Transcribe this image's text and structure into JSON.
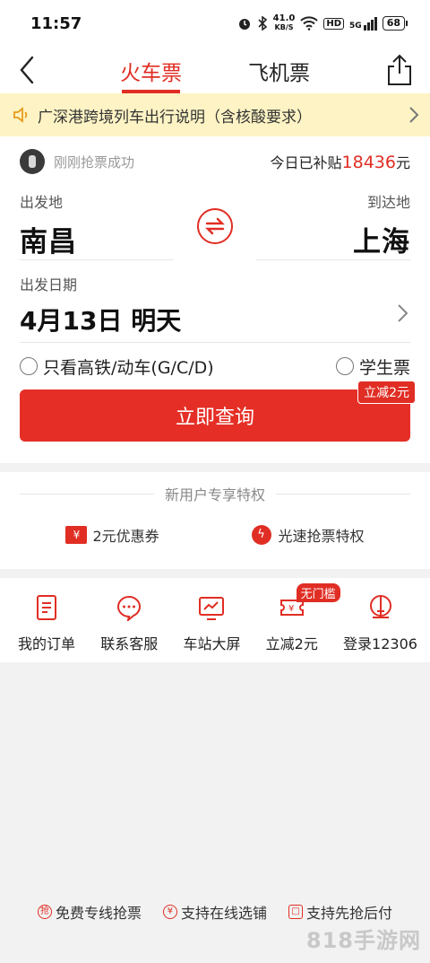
{
  "status_bar": {
    "time": "11:57",
    "speed": "41.0",
    "speed_unit": "KB/S",
    "hd": "HD",
    "network": "5G",
    "battery": "68"
  },
  "nav": {
    "tabs": [
      {
        "label": "火车票",
        "active": true
      },
      {
        "label": "飞机票",
        "active": false
      }
    ]
  },
  "notice": {
    "text": "广深港跨境列车出行说明（含核酸要求）"
  },
  "promo": {
    "left_text": "刚刚抢票成功",
    "right_prefix": "今日已补贴",
    "amount": "18436",
    "unit": "元"
  },
  "route": {
    "from_label": "出发地",
    "from_city": "南昌",
    "to_label": "到达地",
    "to_city": "上海"
  },
  "date": {
    "label": "出发日期",
    "value": "4月13日 明天"
  },
  "options": {
    "high_speed": "只看高铁/动车(G/C/D)",
    "student": "学生票"
  },
  "search": {
    "label": "立即查询",
    "badge": "立减2元"
  },
  "perks": {
    "title": "新用户专享特权",
    "items": [
      {
        "icon": "¥",
        "label": "2元优惠券"
      },
      {
        "icon": "ϟ",
        "label": "光速抢票特权"
      }
    ]
  },
  "quick": {
    "items": [
      {
        "label": "我的订单",
        "icon": "order-icon"
      },
      {
        "label": "联系客服",
        "icon": "chat-icon"
      },
      {
        "label": "车站大屏",
        "icon": "screen-icon"
      },
      {
        "label": "立减2元",
        "icon": "coupon-icon",
        "badge": "无门槛"
      },
      {
        "label": "登录12306",
        "icon": "train-icon"
      }
    ]
  },
  "footer": {
    "items": [
      {
        "icon": "抢",
        "label": "免费专线抢票"
      },
      {
        "icon": "¥",
        "label": "支持在线选铺"
      },
      {
        "icon": "□",
        "label": "支持先抢后付"
      }
    ]
  },
  "watermark": "818手游网",
  "colors": {
    "accent": "#e02e24",
    "notice_bg": "#fdf3c4"
  }
}
